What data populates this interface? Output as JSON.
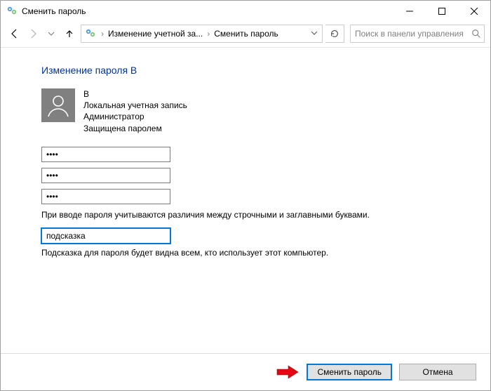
{
  "titlebar": {
    "title": "Сменить пароль"
  },
  "breadcrumb": {
    "segments": [
      "Изменение учетной за...",
      "Сменить пароль"
    ]
  },
  "search": {
    "placeholder": "Поиск в панели управления"
  },
  "page": {
    "heading": "Изменение пароля B"
  },
  "account": {
    "name": "B",
    "type": "Локальная учетная запись",
    "role": "Администратор",
    "protection": "Защищена паролем"
  },
  "fields": {
    "current_password": "••••",
    "new_password": "••••",
    "confirm_password": "••••",
    "case_note": "При вводе пароля учитываются различия между строчными и заглавными буквами.",
    "hint": "подсказка",
    "hint_note": "Подсказка для пароля будет видна всем, кто использует этот компьютер."
  },
  "buttons": {
    "submit": "Сменить пароль",
    "cancel": "Отмена"
  }
}
